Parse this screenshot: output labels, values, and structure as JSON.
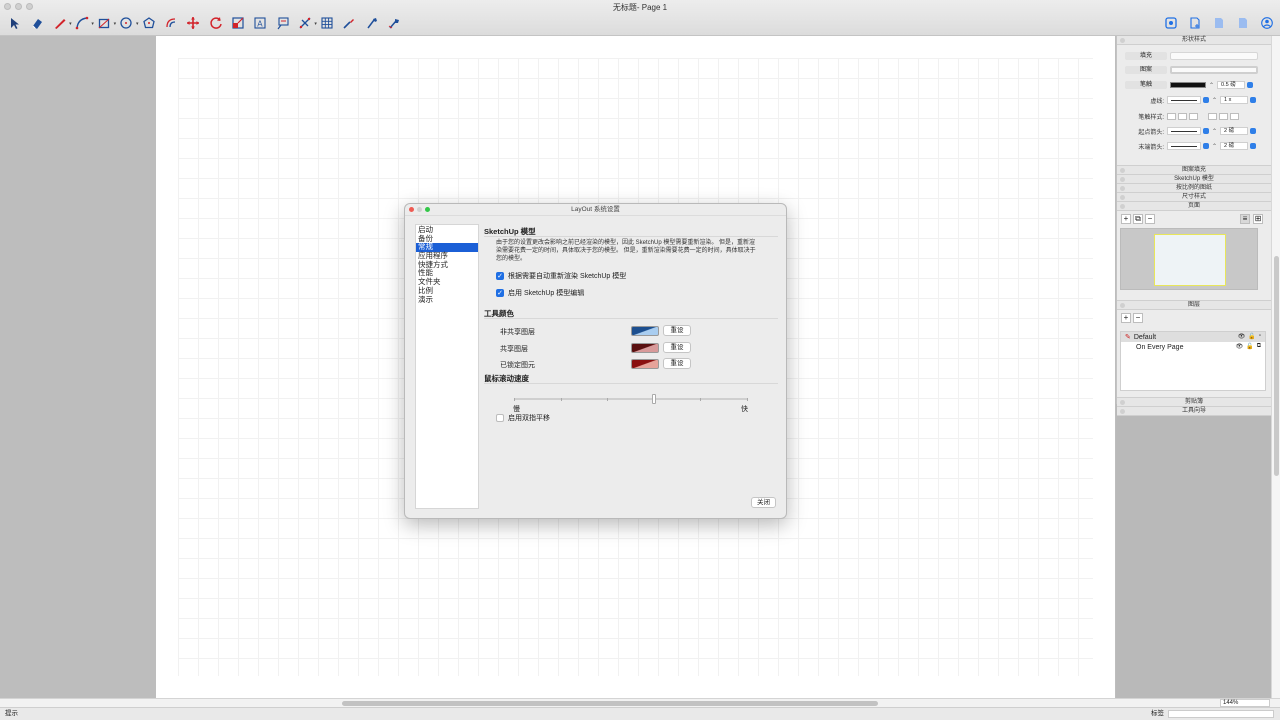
{
  "window": {
    "title": "无标题- Page 1"
  },
  "toolbar": {
    "tools": [
      {
        "icon": "select-arrow-icon",
        "dropdown": false
      },
      {
        "icon": "eraser-icon",
        "dropdown": false
      },
      {
        "icon": "line-pencil-icon",
        "dropdown": true
      },
      {
        "icon": "arc-tool-icon",
        "dropdown": true
      },
      {
        "icon": "rectangle-tool-icon",
        "dropdown": true
      },
      {
        "icon": "circle-tool-icon",
        "dropdown": true
      },
      {
        "icon": "polygon-tool-icon",
        "dropdown": false
      },
      {
        "icon": "offset-tool-icon",
        "dropdown": false
      },
      {
        "icon": "move-tool-icon",
        "dropdown": false
      },
      {
        "icon": "rotate-tool-icon",
        "dropdown": false
      },
      {
        "icon": "scale-tool-icon",
        "dropdown": false
      },
      {
        "icon": "text-tool-icon",
        "dropdown": false
      },
      {
        "icon": "label-tool-icon",
        "dropdown": false
      },
      {
        "icon": "dimension-tool-icon",
        "dropdown": true
      },
      {
        "icon": "table-tool-icon",
        "dropdown": false
      },
      {
        "icon": "eyedropper-icon",
        "dropdown": false
      },
      {
        "icon": "paint-style-icon",
        "dropdown": false
      },
      {
        "icon": "split-tool-icon",
        "dropdown": false
      }
    ],
    "right_tools": [
      "presentation-icon",
      "add-page-icon",
      "previous-page-icon",
      "next-page-icon",
      "user-account-icon"
    ]
  },
  "tray": {
    "shape_style": {
      "title": "形状样式",
      "fill_label": "填充",
      "pattern_label": "图案",
      "stroke_label": "笔触",
      "stroke_weight": "0.5 磅",
      "dash_label": "虚线:",
      "dash_scale": "1 x",
      "stroke_style_label": "笔触样式:",
      "start_arrow_label": "起点箭头:",
      "start_arrow_size": "2 磅",
      "end_arrow_label": "末端箭头:",
      "end_arrow_size": "2 磅"
    },
    "collapsed_panels": [
      "图案填充",
      "SketchUp 模型",
      "按比例的图纸",
      "尺寸样式"
    ],
    "pages": {
      "title": "页面"
    },
    "layers": {
      "title": "图层",
      "items": [
        {
          "name": "Default",
          "selected": true
        },
        {
          "name": "On Every Page",
          "selected": false
        }
      ]
    },
    "bottom_panels": [
      "剪贴簿",
      "工具向导"
    ]
  },
  "dialog": {
    "title": "LayOut 系统设置",
    "nav": [
      {
        "label": "启动",
        "active": false
      },
      {
        "label": "备份",
        "active": false
      },
      {
        "label": "常规",
        "active": true
      },
      {
        "label": "应用程序",
        "active": false
      },
      {
        "label": "快捷方式",
        "active": false
      },
      {
        "label": "性能",
        "active": false
      },
      {
        "label": "文件夹",
        "active": false
      },
      {
        "label": "比例",
        "active": false
      },
      {
        "label": "演示",
        "active": false
      }
    ],
    "sketchup_section": {
      "title": "SketchUp 模型",
      "description": "由于您的设置更改会影响之前已经渲染的模型，因此 SketchUp 模型需要重新渲染。 但是，重新渲染需要花费一定的时间，具体取决于您的模型。 但是，重新渲染需要花费一定的时间，具体取决于您的模型。",
      "options": [
        {
          "label": "根据需要自动重新渲染 SketchUp 模型",
          "checked": true
        },
        {
          "label": "启用 SketchUp 模型编辑",
          "checked": true
        }
      ]
    },
    "tool_colors": {
      "title": "工具颜色",
      "rows": [
        {
          "label": "非共享图层",
          "color_a": "#1d4f8f",
          "color_b": "#a9cdf0",
          "reset": "重设"
        },
        {
          "label": "共享图层",
          "color_a": "#5a1010",
          "color_b": "#d89a9a",
          "reset": "重设"
        },
        {
          "label": "已锁定图元",
          "color_a": "#8a1010",
          "color_b": "#e6a39a",
          "reset": "重设"
        }
      ]
    },
    "scroll_speed": {
      "title": "鼠标滚动速度",
      "slow": "慢",
      "fast": "快",
      "value_fraction": 0.6,
      "ticks": 6,
      "two_finger_pan_label": "启用双指平移",
      "two_finger_pan_checked": false
    },
    "close_label": "关闭"
  },
  "status": {
    "hint": "提示",
    "measure_label": "标签",
    "zoom": "144%"
  },
  "colors": {
    "accent": "#1f6fe4",
    "nav_active": "#1b5fd6",
    "tool_red": "#d2232a",
    "tool_blue": "#1f4f9a"
  }
}
